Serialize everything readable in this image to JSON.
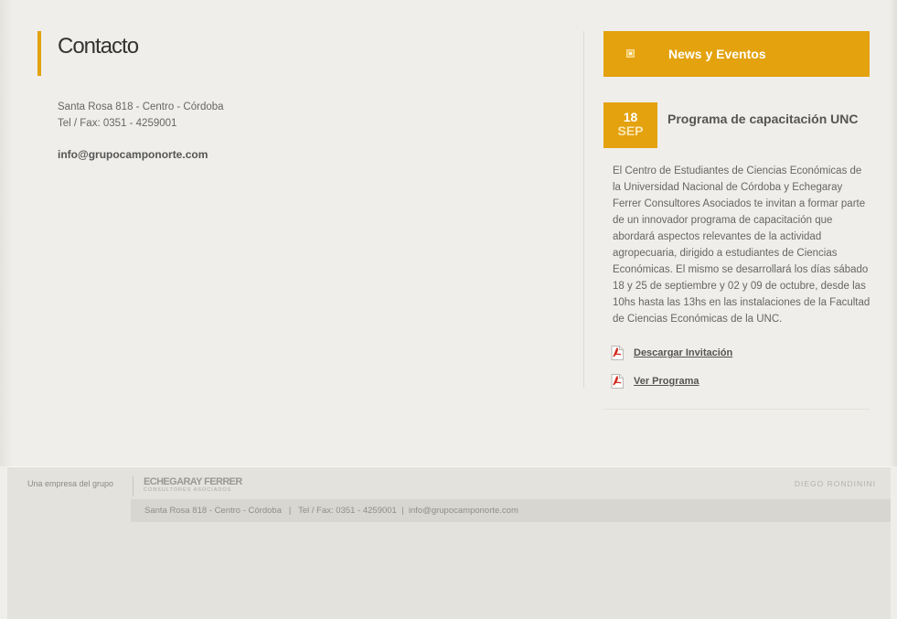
{
  "contact": {
    "title": "Contacto",
    "address_line": "Santa Rosa 818 - Centro - Córdoba",
    "phone_line": "Tel / Fax: 0351 - 4259001",
    "email": "info@grupocamponorte.com"
  },
  "news": {
    "header": "News y Eventos",
    "event": {
      "day": "18",
      "month": "SEP",
      "title": "Programa de capacitación UNC",
      "description": "El Centro de Estudiantes de Ciencias Económicas de la Universidad Nacional de Córdoba y Echegaray Ferrer Consultores Asociados te invitan a formar parte de un innovador programa de capacitación que abordará aspectos relevantes de la actividad agropecuaria, dirigido a estudiantes de Ciencias Económicas. El mismo se desarrollará los días sábado 18 y 25 de septiembre y 02 y 09 de octubre, desde las 10hs hasta las 13hs en las instalaciones de la Facultad de Ciencias Económicas de la UNC.",
      "links": [
        {
          "label": "Descargar Invitación",
          "icon": "pdf-icon"
        },
        {
          "label": "Ver Programa",
          "icon": "pdf-icon"
        }
      ]
    }
  },
  "footer": {
    "group_label": "Una empresa del grupo",
    "logo_main": "ECHEGARAY FERRER",
    "logo_sub": "CONSULTORES ASOCIADOS",
    "credit": "DIEGO RONDININI",
    "contact_line": "Santa Rosa 818 - Centro - Córdoba   |   Tel / Fax: 0351 - 4259001  |  info@grupocamponorte.com"
  },
  "colors": {
    "accent": "#e3a20e",
    "background": "#efeeea",
    "footer": "#e3e2dd"
  }
}
